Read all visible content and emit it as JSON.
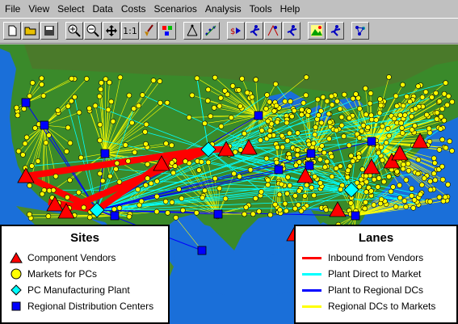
{
  "menu": {
    "items": [
      {
        "label": "File",
        "key": "F"
      },
      {
        "label": "View",
        "key": "V"
      },
      {
        "label": "Select",
        "key": "S"
      },
      {
        "label": "Data",
        "key": "D"
      },
      {
        "label": "Costs",
        "key": "C"
      },
      {
        "label": "Scenarios",
        "key": "S"
      },
      {
        "label": "Analysis",
        "key": "A"
      },
      {
        "label": "Tools",
        "key": "T"
      },
      {
        "label": "Help",
        "key": "H"
      }
    ]
  },
  "toolbar": {
    "zoom_ratio_label": "1:1",
    "buttons": [
      "new-file-icon",
      "open-folder-icon",
      "save-disk-icon",
      "zoom-in-icon",
      "zoom-out-icon",
      "pan-icon",
      "zoom-1to1-icon",
      "broom-icon",
      "color-icon",
      "network-icon",
      "scatter-icon",
      "solver-icon",
      "cost-run-icon",
      "route-run-icon",
      "terrain-icon",
      "flow-run-icon",
      "cluster-icon"
    ]
  },
  "legend_sites": {
    "title": "Sites",
    "items": [
      {
        "label": "Component Vendors",
        "symbol": "triangle",
        "color": "#ff0000"
      },
      {
        "label": "Markets for PCs",
        "symbol": "circle",
        "color": "#ffff00"
      },
      {
        "label": "PC Manufacturing Plant",
        "symbol": "diamond",
        "color": "#00ffff"
      },
      {
        "label": "Regional Distribution Centers",
        "symbol": "square",
        "color": "#0000ff"
      }
    ]
  },
  "legend_lanes": {
    "title": "Lanes",
    "items": [
      {
        "label": "Inbound from Vendors",
        "color": "#ff0000"
      },
      {
        "label": "Plant Direct to Market",
        "color": "#00ffff"
      },
      {
        "label": "Plant to Regional DCs",
        "color": "#0000ff"
      },
      {
        "label": "Regional DCs to Markets",
        "color": "#ffff00"
      }
    ]
  },
  "colors": {
    "ocean": "#1a6fd9",
    "land": "#3a8a2a",
    "vendor": "#ff0000",
    "market": "#ffff00",
    "plant": "#00ffff",
    "dc": "#0000ff"
  }
}
